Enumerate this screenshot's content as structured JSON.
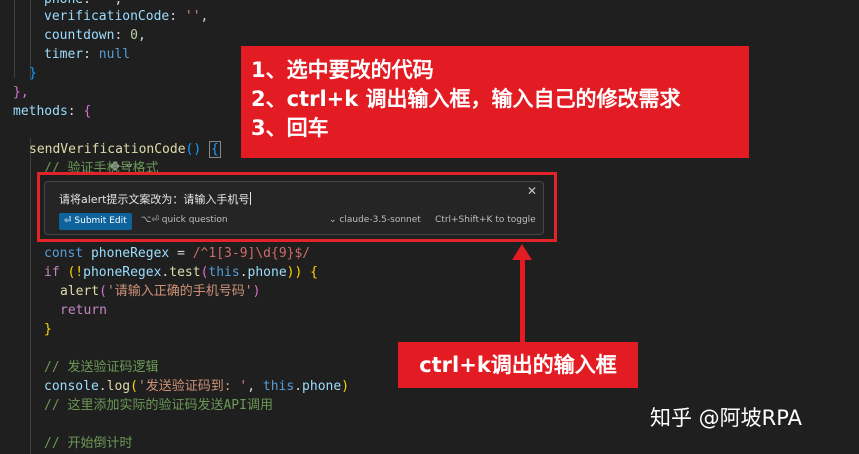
{
  "code": {
    "l0": {
      "key": "phone",
      "val": "''"
    },
    "l1": {
      "key": "verificationCode",
      "val": "''"
    },
    "l2": {
      "key": "countdown",
      "val": "0"
    },
    "l3": {
      "key": "timer",
      "val": "null"
    },
    "l4": "}",
    "l5": "},",
    "l6": {
      "key": "methods",
      "brace": "{"
    },
    "l8": {
      "fn": "sendVerificationCode",
      "parens": "()",
      "brace": "{"
    },
    "l9": "// 验证手机号格式",
    "l13": {
      "kw": "const",
      "name": "phoneRegex",
      "eq": "=",
      "regex": "/^1[3-9]\\d{9}$/"
    },
    "l14": {
      "kw": "if",
      "not": "(!",
      "obj": "phoneRegex",
      "method": "test",
      "this": "this",
      "prop": "phone",
      "end": ")) {"
    },
    "l15": {
      "fn": "alert",
      "arg": "'请输入正确的手机号码'"
    },
    "l16": "return",
    "l17": "}",
    "l19": "// 发送验证码逻辑",
    "l20": {
      "obj": "console",
      "method": "log",
      "arg": "'发送验证码到: '",
      "this": "this",
      "prop": "phone"
    },
    "l21": "// 这里添加实际的验证码发送API调用",
    "l23": "// 开始倒计时"
  },
  "inline_edit": {
    "prompt": "请将alert提示文案改为：请输入手机号",
    "submit_label": "⏎ Submit Edit",
    "quick_question": "⌥⏎ quick question",
    "model": "claude-3.5-sonnet",
    "toggle_hint": "Ctrl+Shift+K to toggle",
    "close": "✕"
  },
  "annotations": {
    "steps": [
      "1、选中要改的代码",
      "2、ctrl+k 调出输入框，输入自己的修改需求",
      "3、回车"
    ],
    "arrow_label": "ctrl+k调出的输入框",
    "accent_color": "#e31b23"
  },
  "watermark": "知乎 @阿坡RPA"
}
